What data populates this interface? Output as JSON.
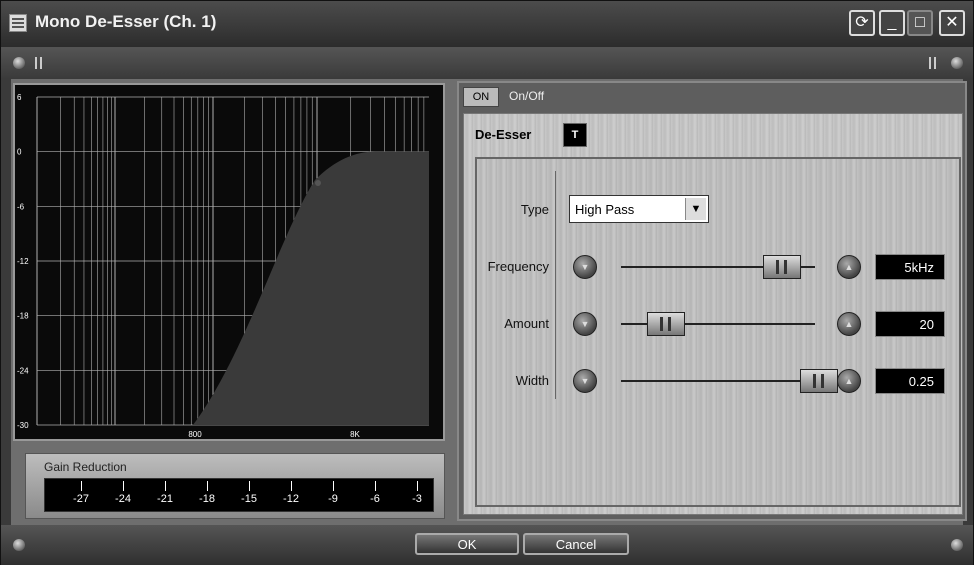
{
  "window": {
    "title": "Mono De-Esser (Ch. 1)",
    "title_buttons": [
      "refresh-icon",
      "minimize-icon",
      "maximize-icon",
      "close-icon"
    ]
  },
  "graph": {
    "y_ticks": [
      "6",
      "0",
      "-6",
      "-12",
      "-18",
      "-24",
      "-30"
    ],
    "x_ticks": [
      "800",
      "8K"
    ],
    "curve_color": "#3a3a3a",
    "grid_color": "#b0b0b0"
  },
  "gain_reduction": {
    "label": "Gain Reduction",
    "ticks": [
      "-27",
      "-24",
      "-21",
      "-18",
      "-15",
      "-12",
      "-9",
      "-6",
      "-3"
    ]
  },
  "toggle": {
    "on_label": "ON",
    "on_off_label": "On/Off"
  },
  "deesser": {
    "label": "De-Esser",
    "t_button": "T",
    "type": {
      "label": "Type",
      "value": "High Pass"
    },
    "frequency": {
      "label": "Frequency",
      "value": "5kHz",
      "slider_fraction": 0.78
    },
    "amount": {
      "label": "Amount",
      "value": "20",
      "slider_fraction": 0.18
    },
    "width": {
      "label": "Width",
      "value": "0.25",
      "slider_fraction": 0.97
    }
  },
  "dialog": {
    "ok_label": "OK",
    "cancel_label": "Cancel"
  }
}
